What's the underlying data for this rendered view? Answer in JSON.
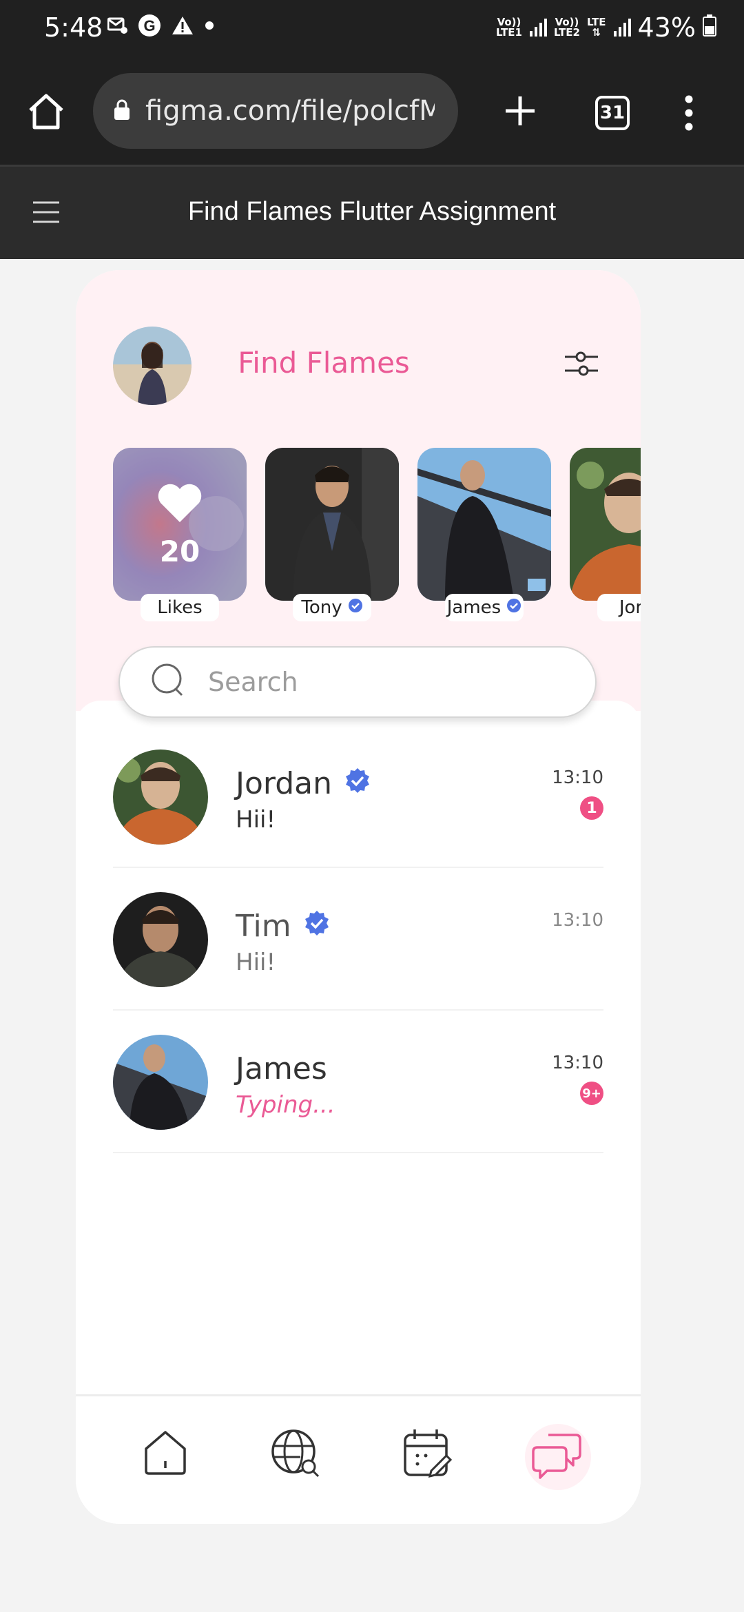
{
  "status_bar": {
    "time": "5:48",
    "battery": "43%",
    "network1": [
      "Vo))",
      "LTE1"
    ],
    "network2": [
      "Vo))",
      "LTE2"
    ],
    "network3": "LTE",
    "icons": [
      "message-settings-icon",
      "google-icon",
      "warning-icon",
      "dot-icon",
      "signal-icon",
      "battery-icon"
    ]
  },
  "browser": {
    "url": "figma.com/file/polcfM",
    "tab_count": "31",
    "icons": [
      "home-icon",
      "lock-icon",
      "new-tab-icon",
      "menu-kebab-icon"
    ]
  },
  "figma": {
    "title": "Find Flames Flutter Assignment",
    "menu_icon": "hamburger-icon"
  },
  "app": {
    "title": "Find Flames",
    "accent_color": "#ea5a95",
    "stories": [
      {
        "label": "Likes",
        "count": "20",
        "verified": false
      },
      {
        "label": "Tony",
        "verified": true
      },
      {
        "label": "James",
        "verified": true
      },
      {
        "label": "Jord",
        "verified": false
      }
    ],
    "search": {
      "placeholder": "Search"
    },
    "chats": [
      {
        "name": "Jordan",
        "verified": true,
        "message": "Hii!",
        "time": "13:10",
        "badge": "1"
      },
      {
        "name": "Tim",
        "verified": true,
        "message": "Hii!",
        "time": "13:10",
        "badge": ""
      },
      {
        "name": "James",
        "verified": false,
        "message": "Typing...",
        "time": "13:10",
        "badge": "9+"
      }
    ],
    "nav": [
      "home-icon",
      "globe-search-icon",
      "calendar-edit-icon",
      "chat-icon"
    ],
    "active_nav": "chat-icon"
  }
}
